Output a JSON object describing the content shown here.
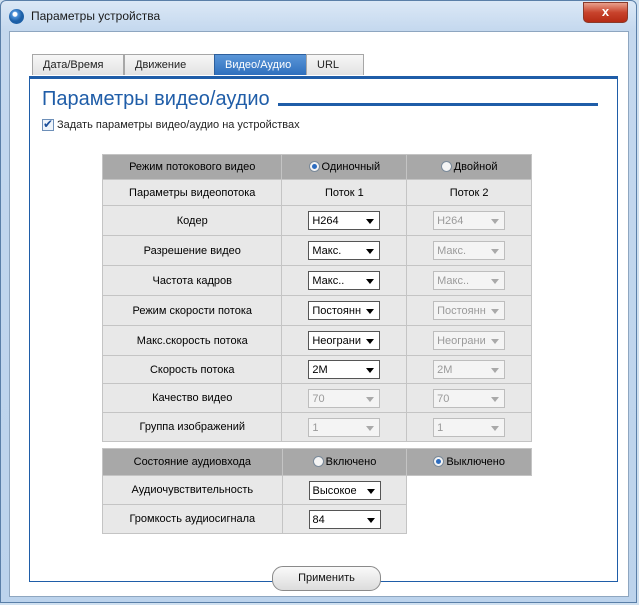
{
  "window": {
    "title": "Параметры устройства",
    "close_label": "x"
  },
  "tabs": [
    {
      "label": "Дата/Время",
      "active": false
    },
    {
      "label": "Движение",
      "active": false
    },
    {
      "label": "Видео/Аудио",
      "active": true
    },
    {
      "label": "URL",
      "active": false
    }
  ],
  "page": {
    "heading": "Параметры видео/аудио",
    "apply_checkbox_label": "Задать параметры видео/аудио на устройствах",
    "apply_checkbox_checked": true
  },
  "video": {
    "mode_label": "Режим потокового видео",
    "mode_single": "Одиночный",
    "mode_dual": "Двойной",
    "mode_selected": "single",
    "params_label": "Параметры видеопотока",
    "stream1": "Поток 1",
    "stream2": "Поток 2",
    "rows": [
      {
        "label": "Кодер",
        "s1": "H264",
        "s1_enabled": true,
        "s2": "H264",
        "s2_enabled": false
      },
      {
        "label": "Разрешение видео",
        "s1": "Макс.",
        "s1_enabled": true,
        "s2": "Макс.",
        "s2_enabled": false
      },
      {
        "label": "Частота кадров",
        "s1": "Макс..",
        "s1_enabled": true,
        "s2": "Макс..",
        "s2_enabled": false
      },
      {
        "label": "Режим скорости потока",
        "s1": "Постоянн",
        "s1_enabled": true,
        "s2": "Постоянн",
        "s2_enabled": false
      },
      {
        "label": "Макс.скорость потока",
        "s1": "Неограни",
        "s1_enabled": true,
        "s2": "Неограни",
        "s2_enabled": false
      },
      {
        "label": "Скорость потока",
        "s1": "2M",
        "s1_enabled": true,
        "s2": "2M",
        "s2_enabled": false
      },
      {
        "label": "Качество видео",
        "s1": "70",
        "s1_enabled": false,
        "s2": "70",
        "s2_enabled": false
      },
      {
        "label": "Группа изображений",
        "s1": "1",
        "s1_enabled": false,
        "s2": "1",
        "s2_enabled": false
      }
    ]
  },
  "audio": {
    "state_label": "Состояние аудиовхода",
    "on_label": "Включено",
    "off_label": "Выключено",
    "state_selected": "off",
    "sensitivity_label": "Аудиочувствительность",
    "sensitivity_value": "Высокое",
    "volume_label": "Громкость аудиосигнала",
    "volume_value": "84"
  },
  "apply_button": "Применить"
}
